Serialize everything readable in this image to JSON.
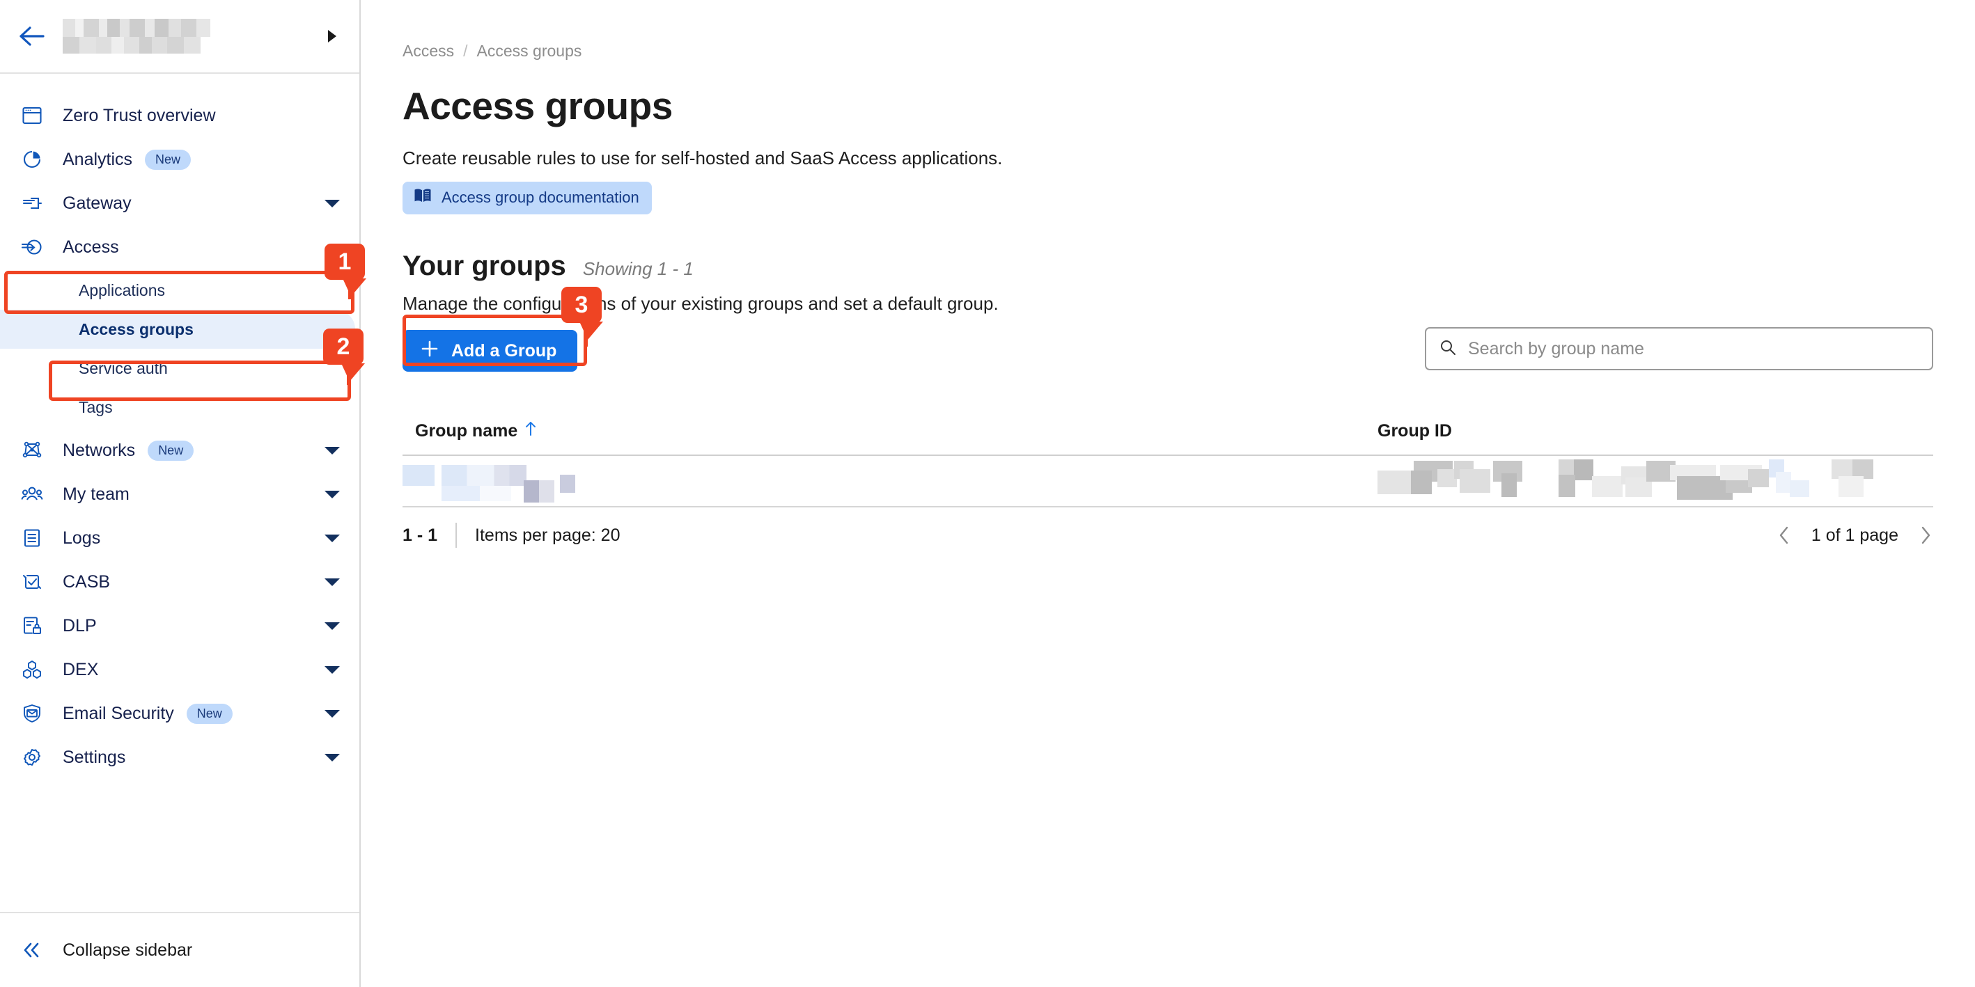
{
  "sidebar": {
    "header": {
      "back_icon": "arrow-left-icon",
      "account_name": "",
      "expand_icon": "triangle-right-icon"
    },
    "items": [
      {
        "label": "Zero Trust overview",
        "icon": "browser-window-icon",
        "badge": "",
        "caret": "none"
      },
      {
        "label": "Analytics",
        "icon": "pie-chart-icon",
        "badge": "New",
        "caret": "none"
      },
      {
        "label": "Gateway",
        "icon": "gateway-icon",
        "badge": "",
        "caret": "down"
      },
      {
        "label": "Access",
        "icon": "access-arrow-icon",
        "badge": "",
        "caret": "up"
      },
      {
        "label": "Networks",
        "icon": "network-mesh-icon",
        "badge": "New",
        "caret": "down"
      },
      {
        "label": "My team",
        "icon": "people-icon",
        "badge": "",
        "caret": "down"
      },
      {
        "label": "Logs",
        "icon": "list-document-icon",
        "badge": "",
        "caret": "down"
      },
      {
        "label": "CASB",
        "icon": "check-refresh-icon",
        "badge": "",
        "caret": "down"
      },
      {
        "label": "DLP",
        "icon": "document-lock-icon",
        "badge": "",
        "caret": "down"
      },
      {
        "label": "DEX",
        "icon": "molecule-icon",
        "badge": "",
        "caret": "down"
      },
      {
        "label": "Email Security",
        "icon": "mail-shield-icon",
        "badge": "New",
        "caret": "down"
      },
      {
        "label": "Settings",
        "icon": "gear-icon",
        "badge": "",
        "caret": "down"
      }
    ],
    "access_subitems": [
      {
        "label": "Applications",
        "active": false
      },
      {
        "label": "Access groups",
        "active": true
      },
      {
        "label": "Service auth",
        "active": false
      },
      {
        "label": "Tags",
        "active": false
      }
    ],
    "footer": {
      "label": "Collapse sidebar",
      "icon": "chevron-double-left-icon"
    }
  },
  "main": {
    "breadcrumb": {
      "parent": "Access",
      "separator": "/",
      "current": "Access groups"
    },
    "title": "Access groups",
    "subtitle": "Create reusable rules to use for self-hosted and SaaS Access applications.",
    "doc_pill": {
      "label": "Access group documentation",
      "icon": "book-icon"
    },
    "groups": {
      "title": "Your groups",
      "showing": "Showing 1 - 1",
      "description": "Manage the configurations of your existing groups and set a default group.",
      "add_button": {
        "label": "Add a Group",
        "icon": "plus-icon"
      }
    },
    "search": {
      "placeholder": "Search by group name",
      "value": "",
      "icon": "search-icon"
    },
    "table": {
      "columns": [
        {
          "label": "Group name",
          "sort": "ascending",
          "sort_icon": "arrow-up-icon"
        },
        {
          "label": "Group ID",
          "sort": "none",
          "sort_icon": ""
        }
      ],
      "rows": [
        {
          "group_name": "",
          "group_id": "",
          "redacted": true
        }
      ]
    },
    "footer": {
      "range": "1 - 1",
      "items_per_page": "Items per page: 20",
      "page_label": "1 of 1 page",
      "prev_icon": "chevron-left-icon",
      "next_icon": "chevron-right-icon"
    }
  },
  "annotations": {
    "accent_color": "#ef4423",
    "steps": [
      {
        "number": "1",
        "target": "sidebar-item-access"
      },
      {
        "number": "2",
        "target": "sidebar-subitem-access-groups"
      },
      {
        "number": "3",
        "target": "add-group-button"
      }
    ]
  },
  "colors": {
    "primary_blue": "#1473e6",
    "nav_icon_blue": "#1057b9",
    "nav_text": "#16214d",
    "badge_new_bg": "#bfd9fb",
    "badge_new_text": "#1a3a7a",
    "active_subitem_bg": "#e7effb",
    "annotation_orange": "#ef4423",
    "muted_text": "#8d8d8d"
  }
}
